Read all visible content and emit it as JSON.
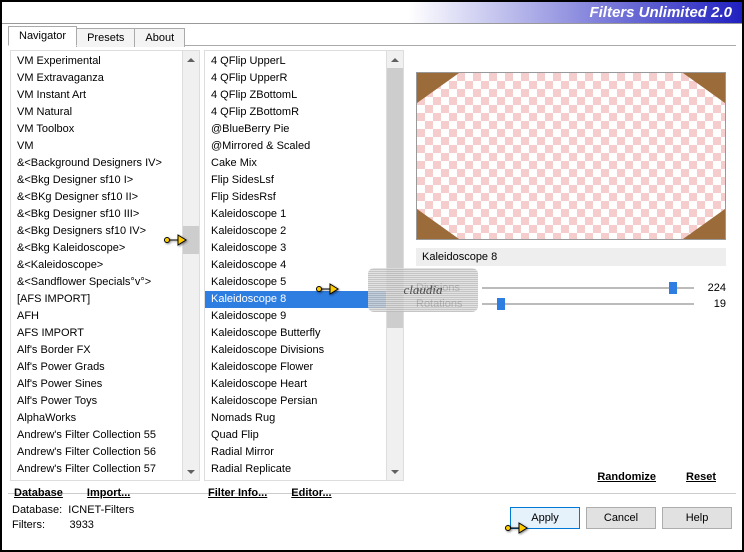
{
  "title": "Filters Unlimited 2.0",
  "tabs": [
    "Navigator",
    "Presets",
    "About"
  ],
  "active_tab": 0,
  "list1": {
    "items": [
      "VM Experimental",
      "VM Extravaganza",
      "VM Instant Art",
      "VM Natural",
      "VM Toolbox",
      "VM",
      "&<Background Designers IV>",
      "&<Bkg Designer sf10 I>",
      "&<BKg Designer sf10 II>",
      "&<Bkg Designer sf10 III>",
      "&<Bkg Designers sf10 IV>",
      "&<Bkg Kaleidoscope>",
      "&<Kaleidoscope>",
      "&<Sandflower Specials°v°>",
      "[AFS IMPORT]",
      "AFH",
      "AFS IMPORT",
      "Alf's Border FX",
      "Alf's Power Grads",
      "Alf's Power Sines",
      "Alf's Power Toys",
      "AlphaWorks",
      "Andrew's Filter Collection 55",
      "Andrew's Filter Collection 56",
      "Andrew's Filter Collection 57"
    ],
    "highlight_index": 11
  },
  "list2": {
    "items": [
      "4 QFlip UpperL",
      "4 QFlip UpperR",
      "4 QFlip ZBottomL",
      "4 QFlip ZBottomR",
      "@BlueBerry Pie",
      "@Mirrored & Scaled",
      "Cake Mix",
      "Flip SidesLsf",
      "Flip SidesRsf",
      "Kaleidoscope 1",
      "Kaleidoscope 2",
      "Kaleidoscope 3",
      "Kaleidoscope 4",
      "Kaleidoscope 5",
      "Kaleidoscope 8",
      "Kaleidoscope 9",
      "Kaleidoscope Butterfly",
      "Kaleidoscope Divisions",
      "Kaleidoscope Flower",
      "Kaleidoscope Heart",
      "Kaleidoscope Persian",
      "Nomads Rug",
      "Quad Flip",
      "Radial Mirror",
      "Radial Replicate"
    ],
    "selected_index": 14
  },
  "links": {
    "database": "Database",
    "import": "Import...",
    "filter_info": "Filter Info...",
    "editor": "Editor...",
    "randomize": "Randomize",
    "reset": "Reset"
  },
  "controls": {
    "title": "Kaleidoscope 8",
    "sliders": [
      {
        "label": "Divisions",
        "value": 224,
        "pos": 88
      },
      {
        "label": "Rotations",
        "value": 19,
        "pos": 7
      }
    ]
  },
  "status": {
    "db_label": "Database:",
    "db_value": "ICNET-Filters",
    "filters_label": "Filters:",
    "filters_value": "3933"
  },
  "buttons": {
    "apply": "Apply",
    "cancel": "Cancel",
    "help": "Help"
  },
  "watermark": "claudia"
}
